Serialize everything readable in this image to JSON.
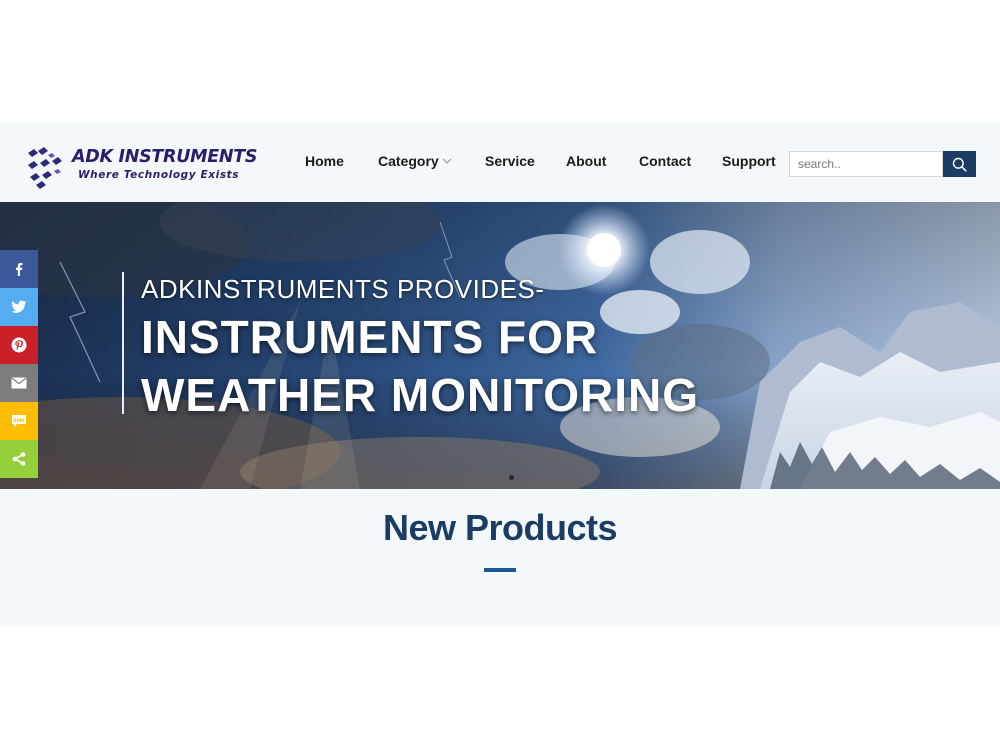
{
  "brand": {
    "name": "ADK INSTRUMENTS",
    "tagline": "Where Technology Exists"
  },
  "nav": {
    "items": [
      {
        "label": "Home"
      },
      {
        "label": "Category",
        "has_dropdown": true
      },
      {
        "label": "Service"
      },
      {
        "label": "About"
      },
      {
        "label": "Contact"
      },
      {
        "label": "Support"
      }
    ]
  },
  "search": {
    "placeholder": "search..",
    "value": "",
    "button_icon": "search-icon"
  },
  "hero": {
    "kicker": "ADKINSTRUMENTS PROVIDES-",
    "line1": "INSTRUMENTS FOR",
    "line2": "WEATHER MONITORING"
  },
  "section": {
    "title": "New Products"
  },
  "share": {
    "buttons": [
      {
        "icon": "facebook-icon",
        "color": "#3b5998"
      },
      {
        "icon": "twitter-icon",
        "color": "#55acee"
      },
      {
        "icon": "pinterest-icon",
        "color": "#cb2027"
      },
      {
        "icon": "email-icon",
        "color": "#7d7d7d"
      },
      {
        "icon": "sms-icon",
        "color": "#ffbd00"
      },
      {
        "icon": "share-icon",
        "color": "#95d03a"
      }
    ]
  },
  "colors": {
    "brand_dark": "#2c1d6b",
    "accent_navy": "#1c3c64",
    "rule_blue": "#1c5794",
    "page_bg": "#f3f8fa"
  }
}
